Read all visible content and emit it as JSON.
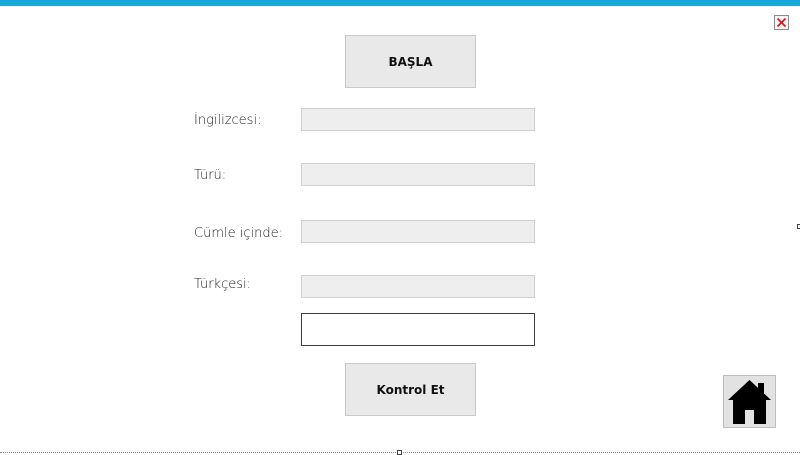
{
  "window": {
    "accent_color": "#17a9dc",
    "close_icon": "close-icon"
  },
  "form": {
    "start_button_label": "BAŞLA",
    "fields": [
      {
        "label": "İngilizcesi:",
        "value": ""
      },
      {
        "label": "Türü:",
        "value": ""
      },
      {
        "label": "Cümle içinde:",
        "value": ""
      },
      {
        "label": "Türkçesi:",
        "value": ""
      }
    ],
    "answer": {
      "value": "",
      "placeholder": ""
    },
    "check_button_label": "Kontrol Et"
  },
  "home_button": {
    "icon": "home-icon"
  }
}
